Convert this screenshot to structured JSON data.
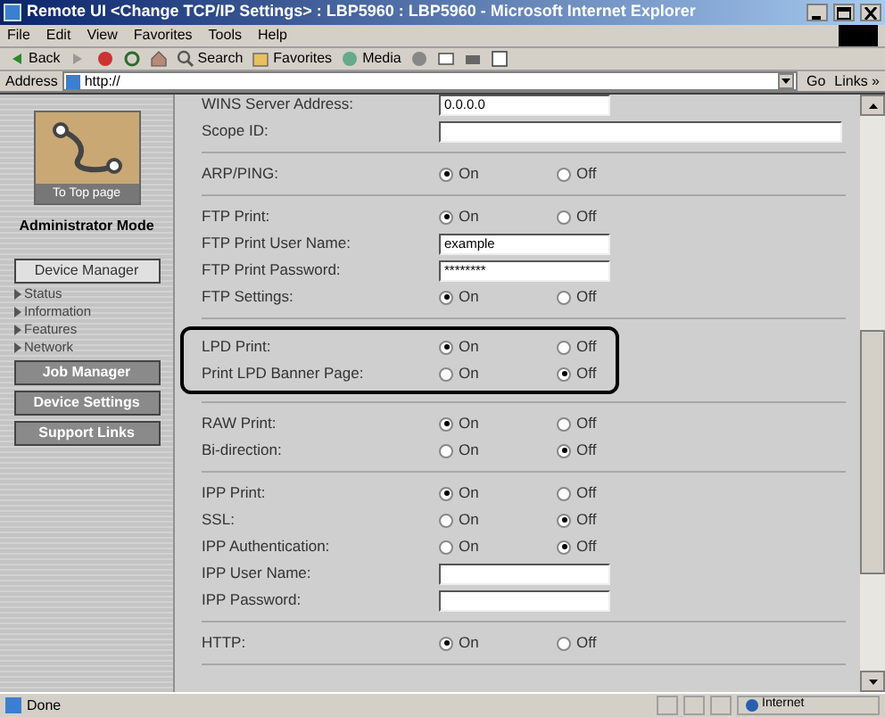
{
  "window": {
    "title": "Remote UI <Change TCP/IP Settings> : LBP5960 : LBP5960 - Microsoft Internet Explorer"
  },
  "menu": [
    "File",
    "Edit",
    "View",
    "Favorites",
    "Tools",
    "Help"
  ],
  "toolbar": [
    {
      "kind": "back",
      "label": "Back"
    },
    {
      "kind": "forward"
    },
    {
      "kind": "stop"
    },
    {
      "kind": "refresh"
    },
    {
      "kind": "home"
    },
    {
      "kind": "search",
      "label": "Search"
    },
    {
      "kind": "favorites",
      "label": "Favorites"
    },
    {
      "kind": "media",
      "label": "Media"
    },
    {
      "kind": "history"
    },
    {
      "kind": "mail"
    },
    {
      "kind": "print"
    },
    {
      "kind": "edit"
    }
  ],
  "address_bar": {
    "label": "Address",
    "value": "http://",
    "go": "Go",
    "links": "Links »"
  },
  "sidebar": {
    "logo_label": "To Top page",
    "mode": "Administrator Mode",
    "items": [
      {
        "kind": "button",
        "label": "Device Manager",
        "selected": true
      },
      {
        "kind": "link",
        "label": "Status"
      },
      {
        "kind": "link",
        "label": "Information"
      },
      {
        "kind": "link",
        "label": "Features"
      },
      {
        "kind": "link",
        "label": "Network"
      },
      {
        "kind": "button",
        "label": "Job Manager",
        "selected": false
      },
      {
        "kind": "button",
        "label": "Device Settings",
        "selected": false
      },
      {
        "kind": "button",
        "label": "Support Links",
        "selected": false
      }
    ]
  },
  "sections": [
    {
      "highlighted": false,
      "rows": [
        {
          "kind": "field",
          "label": "WINS Server Address:",
          "value": "0.0.0.0",
          "wide": false
        },
        {
          "kind": "field",
          "label": "Scope ID:",
          "wide": true
        }
      ]
    },
    {
      "highlighted": false,
      "rows": [
        {
          "kind": "radio",
          "label": "ARP/PING:",
          "options": [
            {
              "label": "On",
              "selected": true
            },
            {
              "label": "Off",
              "selected": false
            }
          ]
        }
      ]
    },
    {
      "highlighted": false,
      "rows": [
        {
          "kind": "radio",
          "label": "FTP Print:",
          "options": [
            {
              "label": "On",
              "selected": true
            },
            {
              "label": "Off",
              "selected": false
            }
          ]
        },
        {
          "kind": "field",
          "label": "FTP Print User Name:",
          "value": "example",
          "wide": false
        },
        {
          "kind": "field",
          "label": "FTP Print Password:",
          "value": "********",
          "wide": false
        },
        {
          "kind": "radio",
          "label": "FTP Settings:",
          "options": [
            {
              "label": "On",
              "selected": true
            },
            {
              "label": "Off",
              "selected": false
            }
          ]
        }
      ]
    },
    {
      "highlighted": true,
      "rows": [
        {
          "kind": "radio",
          "label": "LPD Print:",
          "options": [
            {
              "label": "On",
              "selected": true
            },
            {
              "label": "Off",
              "selected": false
            }
          ]
        },
        {
          "kind": "radio",
          "label": "Print LPD Banner Page:",
          "options": [
            {
              "label": "On",
              "selected": false
            },
            {
              "label": "Off",
              "selected": true
            }
          ]
        }
      ]
    },
    {
      "highlighted": false,
      "rows": [
        {
          "kind": "radio",
          "label": "RAW Print:",
          "options": [
            {
              "label": "On",
              "selected": true
            },
            {
              "label": "Off",
              "selected": false
            }
          ]
        },
        {
          "kind": "radio",
          "label": "Bi-direction:",
          "options": [
            {
              "label": "On",
              "selected": false
            },
            {
              "label": "Off",
              "selected": true
            }
          ]
        }
      ]
    },
    {
      "highlighted": false,
      "rows": [
        {
          "kind": "radio",
          "label": "IPP Print:",
          "options": [
            {
              "label": "On",
              "selected": true
            },
            {
              "label": "Off",
              "selected": false
            }
          ]
        },
        {
          "kind": "radio",
          "label": "SSL:",
          "options": [
            {
              "label": "On",
              "selected": false
            },
            {
              "label": "Off",
              "selected": true
            }
          ]
        },
        {
          "kind": "radio",
          "label": "IPP Authentication:",
          "options": [
            {
              "label": "On",
              "selected": false
            },
            {
              "label": "Off",
              "selected": true
            }
          ]
        },
        {
          "kind": "field",
          "label": "IPP User Name:",
          "wide": false
        },
        {
          "kind": "field",
          "label": "IPP Password:",
          "wide": false
        }
      ]
    },
    {
      "highlighted": false,
      "rows": [
        {
          "kind": "radio",
          "label": "HTTP:",
          "options": [
            {
              "label": "On",
              "selected": true
            },
            {
              "label": "Off",
              "selected": false
            }
          ]
        }
      ]
    }
  ],
  "status_bar": {
    "text": "Done",
    "zone": "Internet"
  }
}
